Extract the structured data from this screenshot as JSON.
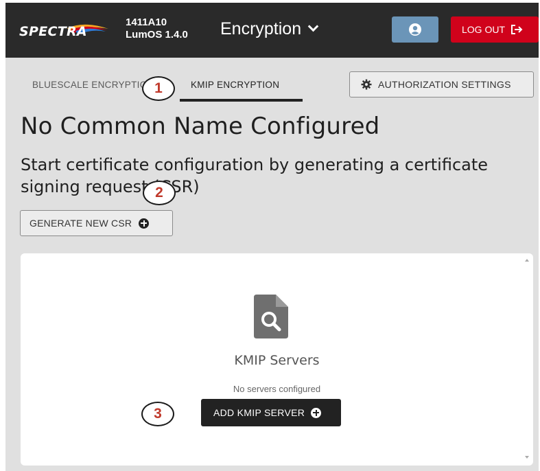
{
  "header": {
    "brand": "SPECTRA",
    "system_name": "1411A10",
    "version": "LumOS 1.4.0",
    "page_menu_label": "Encryption",
    "logout_label": "LOG OUT",
    "brand_color": "#d0021b",
    "user_button_color": "#6b95b8"
  },
  "tabs": [
    {
      "label": "BLUESCALE ENCRYPTION",
      "selected": false
    },
    {
      "label": "KMIP ENCRYPTION",
      "selected": true
    }
  ],
  "auth_button_label": "AUTHORIZATION SETTINGS",
  "title": "No Common Name Configured",
  "subtitle": "Start certificate configuration by generating a certificate signing request (CSR)",
  "generate_button_label": "GENERATE NEW CSR",
  "card": {
    "title": "KMIP Servers",
    "empty_text": "No servers configured",
    "add_button_label": "ADD KMIP SERVER",
    "icon": "file-search-icon"
  },
  "callouts": [
    "1",
    "2",
    "3"
  ]
}
